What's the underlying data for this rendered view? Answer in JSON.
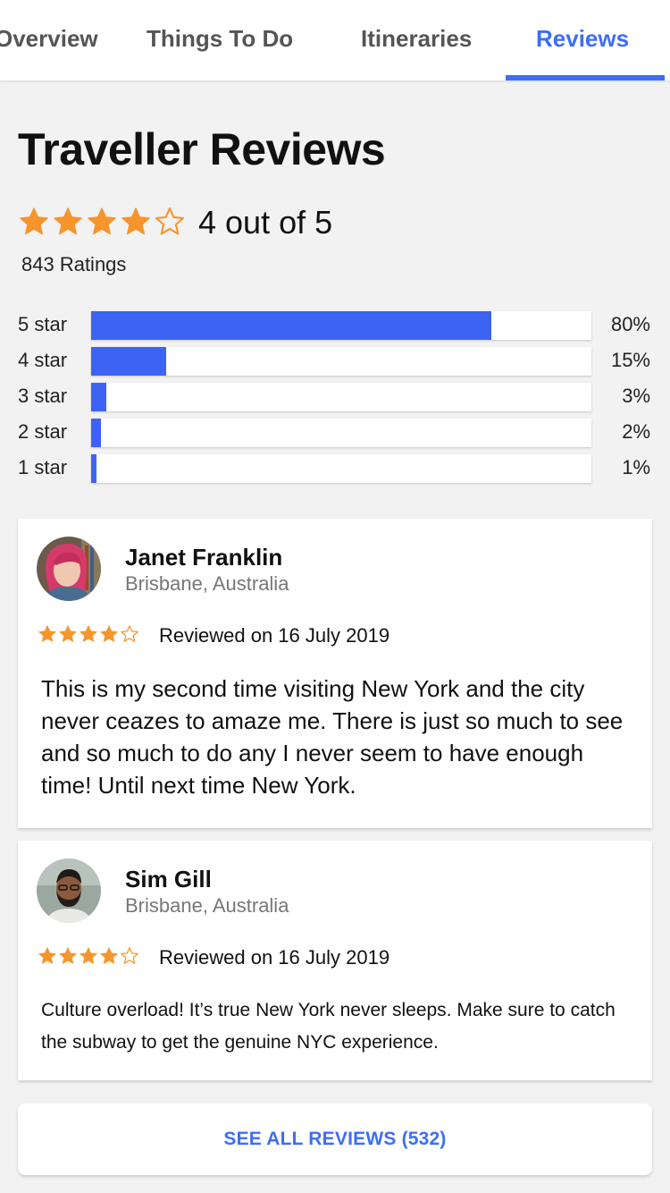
{
  "tabs": [
    {
      "label": "Overview",
      "active": false
    },
    {
      "label": "Things To Do",
      "active": false
    },
    {
      "label": "Itineraries",
      "active": false
    },
    {
      "label": "Reviews",
      "active": true
    }
  ],
  "summary": {
    "title": "Traveller Reviews",
    "rating": 4,
    "rating_max": 5,
    "rating_text": "4 out of 5",
    "ratings_count": "843 Ratings"
  },
  "distribution": [
    {
      "label": "5 star",
      "percent": 80,
      "percent_text": "80%"
    },
    {
      "label": "4 star",
      "percent": 15,
      "percent_text": "15%"
    },
    {
      "label": "3 star",
      "percent": 3,
      "percent_text": "3%"
    },
    {
      "label": "2 star",
      "percent": 2,
      "percent_text": "2%"
    },
    {
      "label": "1 star",
      "percent": 1,
      "percent_text": "1%"
    }
  ],
  "reviews": [
    {
      "name": "Janet Franklin",
      "location": "Brisbane, Australia",
      "rating": 4,
      "date": "Reviewed on 16 July 2019",
      "body": "This is my second time visiting New York and the city never ceazes to amaze me. There is just so much to see and so much to do any I never seem to have enough time! Until next time New York."
    },
    {
      "name": "Sim Gill",
      "location": "Brisbane, Australia",
      "rating": 4,
      "date": "Reviewed on 16 July 2019",
      "body": "Culture overload! It’s true New York never sleeps. Make sure to catch the subway to get the genuine NYC experience."
    }
  ],
  "see_all_label": "SEE ALL REVIEWS (532)",
  "colors": {
    "accent": "#3d6ef5",
    "bar_fill": "#3d63f5",
    "star": "#f7952d",
    "background": "#f2f2f2"
  },
  "icons": {
    "star_filled": "star-filled-icon",
    "star_outline": "star-outline-icon"
  }
}
